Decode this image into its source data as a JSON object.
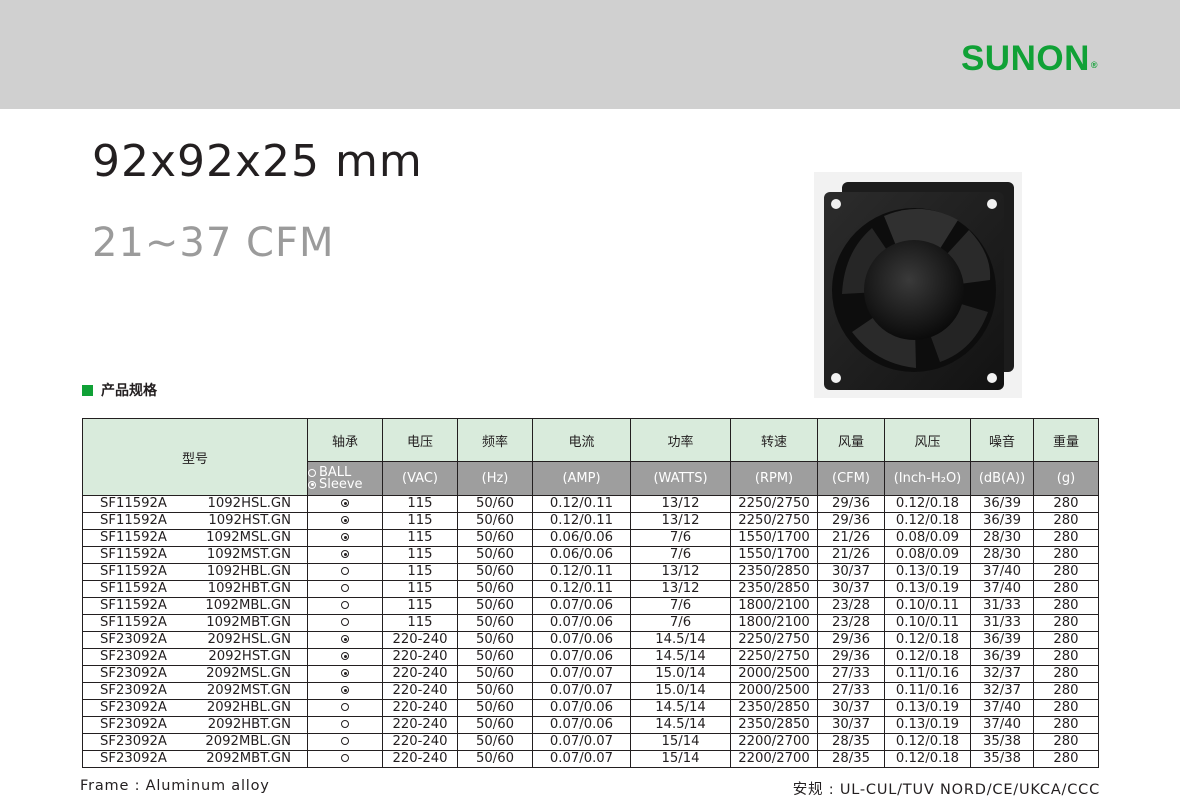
{
  "brand": {
    "name": "SUNON",
    "mark": "®",
    "color": "#10a136"
  },
  "title": {
    "size": "92x92x25 mm",
    "cfm": "21~37 CFM"
  },
  "section": {
    "label": "产品规格"
  },
  "table": {
    "headers": [
      "型号",
      "轴承",
      "电压",
      "频率",
      "电流",
      "功率",
      "转速",
      "风量",
      "风压",
      "噪音",
      "重量"
    ],
    "bearing_legend": {
      "ball": "BALL",
      "sleeve": "Sleeve"
    },
    "units": [
      "(VAC)",
      "(Hz)",
      "(AMP)",
      "(WATTS)",
      "(RPM)",
      "(CFM)",
      "(Inch-H₂O)",
      "(dB(A))",
      "(g)"
    ],
    "rows": [
      {
        "model_a": "SF11592A",
        "model_b": "1092HSL.GN",
        "bearing": "sleeve",
        "voltage": "115",
        "freq": "50/60",
        "current": "0.12/0.11",
        "power": "13/12",
        "rpm": "2250/2750",
        "cfm": "29/36",
        "pressure": "0.12/0.18",
        "noise": "36/39",
        "weight": "280"
      },
      {
        "model_a": "SF11592A",
        "model_b": "1092HST.GN",
        "bearing": "sleeve",
        "voltage": "115",
        "freq": "50/60",
        "current": "0.12/0.11",
        "power": "13/12",
        "rpm": "2250/2750",
        "cfm": "29/36",
        "pressure": "0.12/0.18",
        "noise": "36/39",
        "weight": "280"
      },
      {
        "model_a": "SF11592A",
        "model_b": "1092MSL.GN",
        "bearing": "sleeve",
        "voltage": "115",
        "freq": "50/60",
        "current": "0.06/0.06",
        "power": "7/6",
        "rpm": "1550/1700",
        "cfm": "21/26",
        "pressure": "0.08/0.09",
        "noise": "28/30",
        "weight": "280"
      },
      {
        "model_a": "SF11592A",
        "model_b": "1092MST.GN",
        "bearing": "sleeve",
        "voltage": "115",
        "freq": "50/60",
        "current": "0.06/0.06",
        "power": "7/6",
        "rpm": "1550/1700",
        "cfm": "21/26",
        "pressure": "0.08/0.09",
        "noise": "28/30",
        "weight": "280"
      },
      {
        "model_a": "SF11592A",
        "model_b": "1092HBL.GN",
        "bearing": "ball",
        "voltage": "115",
        "freq": "50/60",
        "current": "0.12/0.11",
        "power": "13/12",
        "rpm": "2350/2850",
        "cfm": "30/37",
        "pressure": "0.13/0.19",
        "noise": "37/40",
        "weight": "280"
      },
      {
        "model_a": "SF11592A",
        "model_b": "1092HBT.GN",
        "bearing": "ball",
        "voltage": "115",
        "freq": "50/60",
        "current": "0.12/0.11",
        "power": "13/12",
        "rpm": "2350/2850",
        "cfm": "30/37",
        "pressure": "0.13/0.19",
        "noise": "37/40",
        "weight": "280"
      },
      {
        "model_a": "SF11592A",
        "model_b": "1092MBL.GN",
        "bearing": "ball",
        "voltage": "115",
        "freq": "50/60",
        "current": "0.07/0.06",
        "power": "7/6",
        "rpm": "1800/2100",
        "cfm": "23/28",
        "pressure": "0.10/0.11",
        "noise": "31/33",
        "weight": "280"
      },
      {
        "model_a": "SF11592A",
        "model_b": "1092MBT.GN",
        "bearing": "ball",
        "voltage": "115",
        "freq": "50/60",
        "current": "0.07/0.06",
        "power": "7/6",
        "rpm": "1800/2100",
        "cfm": "23/28",
        "pressure": "0.10/0.11",
        "noise": "31/33",
        "weight": "280"
      },
      {
        "model_a": "SF23092A",
        "model_b": "2092HSL.GN",
        "bearing": "sleeve",
        "voltage": "220-240",
        "freq": "50/60",
        "current": "0.07/0.06",
        "power": "14.5/14",
        "rpm": "2250/2750",
        "cfm": "29/36",
        "pressure": "0.12/0.18",
        "noise": "36/39",
        "weight": "280"
      },
      {
        "model_a": "SF23092A",
        "model_b": "2092HST.GN",
        "bearing": "sleeve",
        "voltage": "220-240",
        "freq": "50/60",
        "current": "0.07/0.06",
        "power": "14.5/14",
        "rpm": "2250/2750",
        "cfm": "29/36",
        "pressure": "0.12/0.18",
        "noise": "36/39",
        "weight": "280"
      },
      {
        "model_a": "SF23092A",
        "model_b": "2092MSL.GN",
        "bearing": "sleeve",
        "voltage": "220-240",
        "freq": "50/60",
        "current": "0.07/0.07",
        "power": "15.0/14",
        "rpm": "2000/2500",
        "cfm": "27/33",
        "pressure": "0.11/0.16",
        "noise": "32/37",
        "weight": "280"
      },
      {
        "model_a": "SF23092A",
        "model_b": "2092MST.GN",
        "bearing": "sleeve",
        "voltage": "220-240",
        "freq": "50/60",
        "current": "0.07/0.07",
        "power": "15.0/14",
        "rpm": "2000/2500",
        "cfm": "27/33",
        "pressure": "0.11/0.16",
        "noise": "32/37",
        "weight": "280"
      },
      {
        "model_a": "SF23092A",
        "model_b": "2092HBL.GN",
        "bearing": "ball",
        "voltage": "220-240",
        "freq": "50/60",
        "current": "0.07/0.06",
        "power": "14.5/14",
        "rpm": "2350/2850",
        "cfm": "30/37",
        "pressure": "0.13/0.19",
        "noise": "37/40",
        "weight": "280"
      },
      {
        "model_a": "SF23092A",
        "model_b": "2092HBT.GN",
        "bearing": "ball",
        "voltage": "220-240",
        "freq": "50/60",
        "current": "0.07/0.06",
        "power": "14.5/14",
        "rpm": "2350/2850",
        "cfm": "30/37",
        "pressure": "0.13/0.19",
        "noise": "37/40",
        "weight": "280"
      },
      {
        "model_a": "SF23092A",
        "model_b": "2092MBL.GN",
        "bearing": "ball",
        "voltage": "220-240",
        "freq": "50/60",
        "current": "0.07/0.07",
        "power": "15/14",
        "rpm": "2200/2700",
        "cfm": "28/35",
        "pressure": "0.12/0.18",
        "noise": "35/38",
        "weight": "280"
      },
      {
        "model_a": "SF23092A",
        "model_b": "2092MBT.GN",
        "bearing": "ball",
        "voltage": "220-240",
        "freq": "50/60",
        "current": "0.07/0.07",
        "power": "15/14",
        "rpm": "2200/2700",
        "cfm": "28/35",
        "pressure": "0.12/0.18",
        "noise": "35/38",
        "weight": "280"
      }
    ]
  },
  "footer": {
    "frame": "Frame : Aluminum alloy",
    "safety": "安规 : UL-CUL/TUV NORD/CE/UKCA/CCC"
  }
}
